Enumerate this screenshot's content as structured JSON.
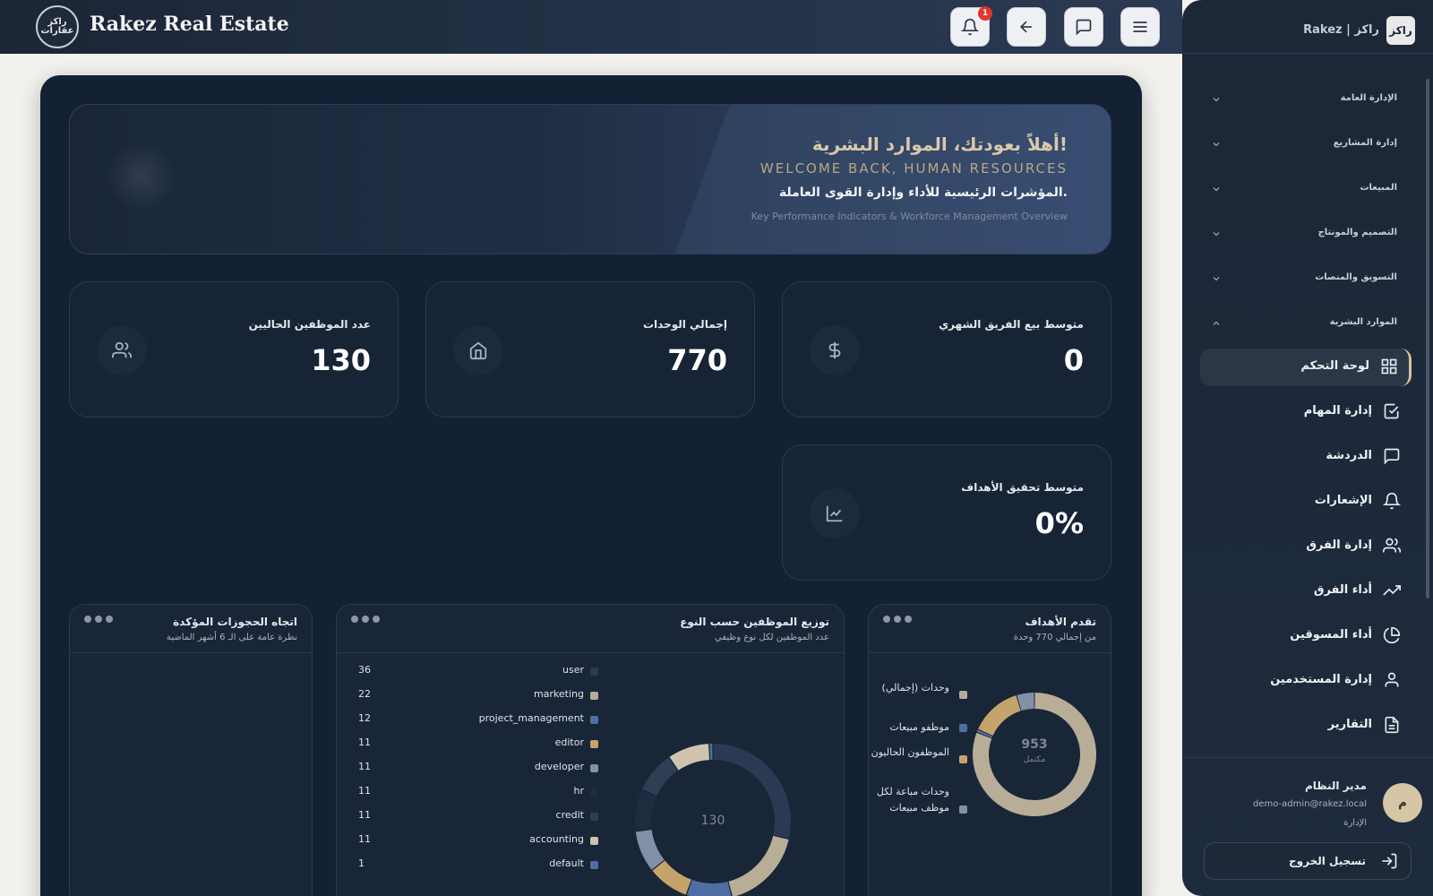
{
  "brand": {
    "title": "Rakez Real Estate",
    "logo_text": "راكز عقارات"
  },
  "topbar": {
    "notification_count": "1"
  },
  "hero": {
    "title": "أهلاً بعودتك، الموارد البشرية!",
    "subtitle_en": "WELCOME BACK, HUMAN RESOURCES",
    "desc_ar": "المؤشرات الرئيسية للأداء وإدارة القوى العاملة.",
    "desc_en": "Key Performance Indicators & Workforce Management Overview"
  },
  "stats": [
    {
      "label": "متوسط بيع الفريق الشهري",
      "value": "0",
      "icon": "dollar-icon"
    },
    {
      "label": "إجمالي الوحدات",
      "value": "770",
      "icon": "home-icon"
    },
    {
      "label": "عدد الموظفين الحاليين",
      "value": "130",
      "icon": "users-icon"
    },
    {
      "label": "متوسط تحقيق الأهداف",
      "value": "0%",
      "icon": "chart-line-icon"
    }
  ],
  "goals_card": {
    "title": "تقدم الأهداف",
    "subtitle": "من إجمالي 770 وحدة",
    "center_value": "953",
    "center_label": "مكتمل",
    "legend": [
      {
        "label": "وحدات (إجمالي)",
        "color": "#b8ad97"
      },
      {
        "label": "موظفو مبيعات",
        "color": "#4f6ea3"
      },
      {
        "label": "الموظفون الحاليون",
        "color": "#c4a46a"
      },
      {
        "label": "وحدات مباعة لكل موظف مبيعات",
        "color": "#8190a8"
      }
    ]
  },
  "employees_card": {
    "title": "توزيع الموظفين حسب النوع",
    "subtitle": "عدد الموظفين لكل نوع وظيفي",
    "center_value": "130"
  },
  "bookings_card": {
    "title": "اتجاه الحجوزات المؤكدة",
    "subtitle": "نظرة عامة على الـ 6 أشهر الماضية"
  },
  "chart_data": [
    {
      "type": "pie",
      "title": "توزيع الموظفين حسب النوع",
      "categories": [
        "user",
        "marketing",
        "project_management",
        "editor",
        "developer",
        "hr",
        "credit",
        "accounting",
        "default"
      ],
      "values": [
        36,
        22,
        12,
        11,
        11,
        11,
        11,
        11,
        1
      ],
      "colors": [
        "#2a3a52",
        "#b8ad97",
        "#4f6ea3",
        "#c4a46a",
        "#8190a8",
        "#1f2c3f",
        "#2e3e55",
        "#cfc3ad",
        "#4f6ea3"
      ],
      "legend": "left"
    },
    {
      "type": "pie",
      "title": "تقدم الأهداف",
      "categories": [
        "وحدات (إجمالي)",
        "موظفو مبيعات",
        "الموظفون الحاليون",
        "وحدات مباعة لكل موظف مبيعات"
      ],
      "values": [
        770,
        8,
        130,
        45
      ],
      "colors": [
        "#b8ad97",
        "#4f6ea3",
        "#c4a46a",
        "#8190a8"
      ],
      "legend": "left"
    }
  ],
  "sidebar": {
    "brand": "Rakez | راكز",
    "logo": "راكز",
    "groups": [
      {
        "label": "الإدارة العامة",
        "expanded": false
      },
      {
        "label": "إدارة المشاريع",
        "expanded": false
      },
      {
        "label": "المبيعات",
        "expanded": false
      },
      {
        "label": "التصميم والمونتاج",
        "expanded": false
      },
      {
        "label": "التسويق والمنصات",
        "expanded": false
      },
      {
        "label": "الموارد البشرية",
        "expanded": true
      }
    ],
    "items": [
      {
        "label": "لوحة التحكم",
        "icon": "grid-icon",
        "active": true
      },
      {
        "label": "إدارة المهام",
        "icon": "check-square-icon"
      },
      {
        "label": "الدردشة",
        "icon": "chat-icon"
      },
      {
        "label": "الإشعارات",
        "icon": "bell-icon"
      },
      {
        "label": "إدارة الفرق",
        "icon": "users-icon"
      },
      {
        "label": "أداء الفرق",
        "icon": "trending-up-icon"
      },
      {
        "label": "أداء المسوقين",
        "icon": "pie-chart-icon"
      },
      {
        "label": "إدارة المستخدمين",
        "icon": "user-icon"
      },
      {
        "label": "التقارير",
        "icon": "file-icon"
      }
    ],
    "user": {
      "name": "مدير النظام",
      "email": "demo-admin@rakez.local",
      "role": "الإدارة",
      "avatar": "م"
    },
    "logout_label": "تسجيل الخروج"
  }
}
